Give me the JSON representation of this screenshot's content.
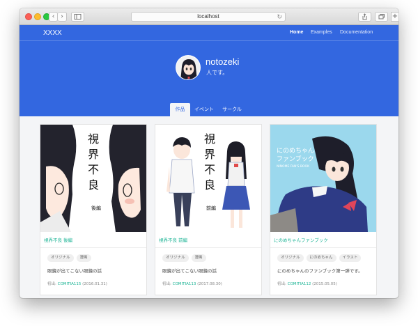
{
  "browser": {
    "url": "localhost",
    "back_glyph": "‹",
    "forward_glyph": "›",
    "plus_glyph": "+",
    "reload_glyph": "↻"
  },
  "navbar": {
    "brand": "XXXX",
    "links": [
      "Home",
      "Examples",
      "Documentation"
    ]
  },
  "profile": {
    "name": "notozeki",
    "description": "人です。"
  },
  "tabs": [
    "作品",
    "イベント",
    "サークル"
  ],
  "cards": [
    {
      "title": "視界不良 後編",
      "cover_title": [
        "視",
        "界",
        "不",
        "良"
      ],
      "cover_sub": "後編",
      "tags": [
        "オリジナル",
        "漫画"
      ],
      "description": "眼鏡が出てこない眼鏡の話",
      "event_prefix": "初出:",
      "event_name": "COMITIA115",
      "event_date": "(2016.01.31)"
    },
    {
      "title": "視界不良 前編",
      "cover_title": [
        "視",
        "界",
        "不",
        "良"
      ],
      "cover_sub": "前編",
      "tags": [
        "オリジナル",
        "漫画"
      ],
      "description": "眼鏡が出てこない眼鏡の話",
      "event_prefix": "初出:",
      "event_name": "COMITIA113",
      "event_date": "(2017.08.30)"
    },
    {
      "title": "にのめちゃんファンブック",
      "cover_title_jp": "にのめちゃん",
      "cover_title_jp2": "ファンブック",
      "cover_title_en": "NINOME FAN'S BOOK",
      "tags": [
        "オリジナル",
        "にのめちゃん",
        "イラスト"
      ],
      "description": "にのめちゃんのファンブック第一弾です。",
      "event_prefix": "初出:",
      "event_name": "COMITIA112",
      "event_date": "(2015.05.05)"
    }
  ],
  "colors": {
    "hero": "#3367e0",
    "accent": "#1ab394"
  }
}
